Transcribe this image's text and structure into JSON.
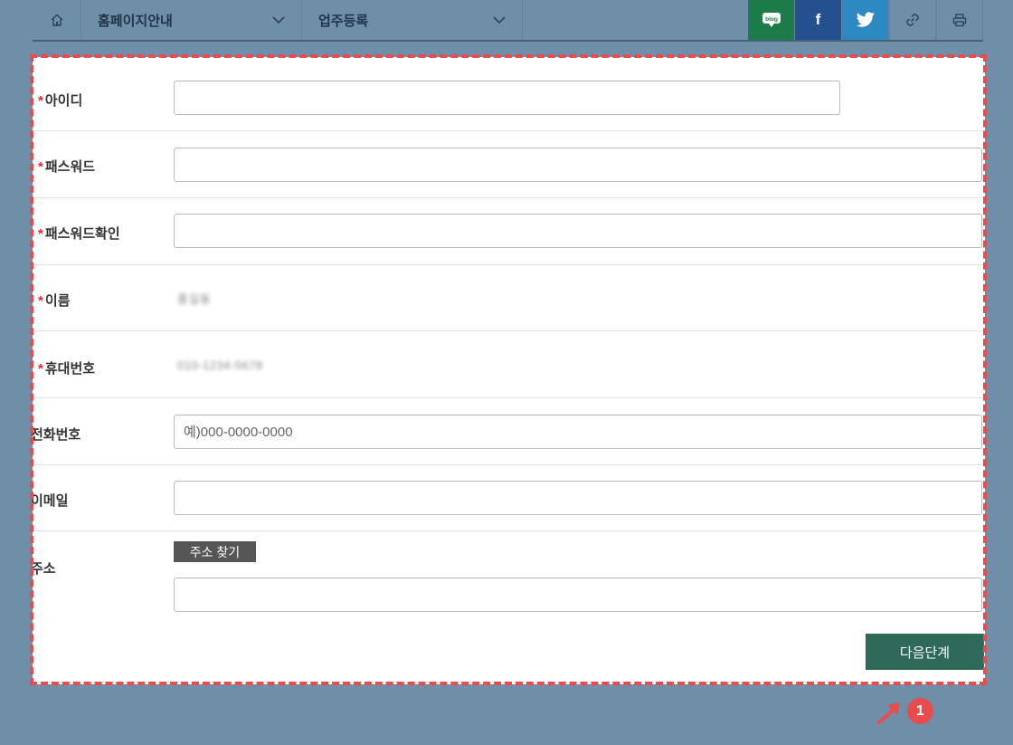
{
  "nav": {
    "home_icon": "home-icon",
    "menu1": "홈페이지안내",
    "menu2": "업주등록",
    "blog_text": "blog",
    "facebook_text": "f",
    "link_icon": "link-icon",
    "print_icon": "print-icon"
  },
  "form": {
    "id_label": "아이디",
    "password_label": "패스워드",
    "password_confirm_label": "패스워드확인",
    "name_label": "이름",
    "name_value": "홍길동",
    "mobile_label": "휴대번호",
    "mobile_value": "010-1234-5678",
    "phone_label": "전화번호",
    "phone_placeholder": "예)000-0000-0000",
    "email_label": "이메일",
    "address_label": "주소",
    "address_button": "주소 찾기",
    "next_button": "다음단계"
  },
  "annotation": {
    "badge": "1",
    "color": "#e94c4c"
  },
  "colors": {
    "background": "#6f8fa9",
    "blog": "#1b7c4a",
    "facebook": "#25508f",
    "twitter": "#2c89c2",
    "next_button": "#2f6a58",
    "required": "#e22233"
  }
}
